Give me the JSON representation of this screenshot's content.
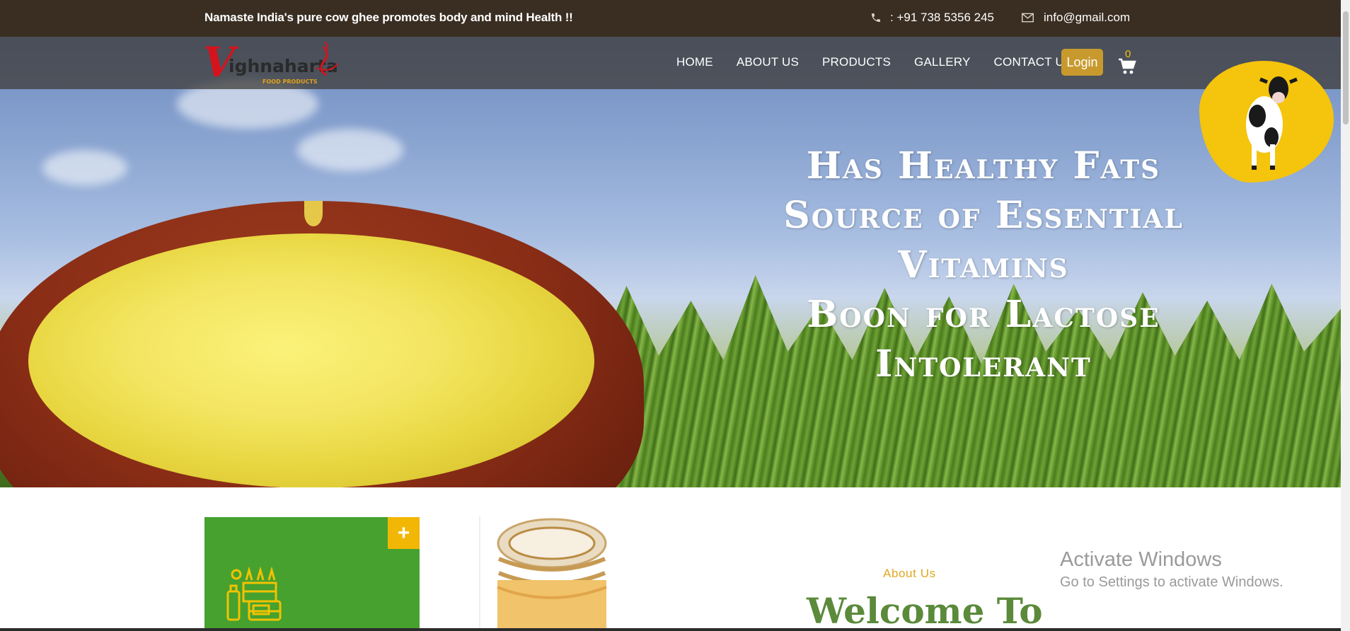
{
  "topbar": {
    "tagline": "Namaste India's pure cow ghee promotes body and mind Health !!",
    "phone": ": +91 738 5356 245",
    "email": "info@gmail.com",
    "phone_icon": "phone-icon",
    "email_icon": "envelope-icon"
  },
  "brand": {
    "logo_text": "ighnaharta",
    "logo_initial": "V",
    "logo_sub": "FOOD PRODUCTS"
  },
  "nav": {
    "items": [
      {
        "label": "HOME"
      },
      {
        "label": "ABOUT US"
      },
      {
        "label": "PRODUCTS"
      },
      {
        "label": "GALLERY"
      },
      {
        "label": "CONTACT US"
      }
    ],
    "login_label": "Login",
    "cart_count": "0",
    "cart_icon": "shopping-cart-icon"
  },
  "hero": {
    "lines": [
      "Has Healthy Fats",
      "Source of Essential Vitamins",
      "Boon for Lactose Intolerant"
    ]
  },
  "feature": {
    "plus_label": "+",
    "icon": "farm-products-icon"
  },
  "about": {
    "label": "About Us",
    "heading": "Welcome To"
  },
  "watermark": {
    "title": "Activate Windows",
    "subtitle": "Go to Settings to activate Windows."
  },
  "colors": {
    "topbar_bg": "#3a2e22",
    "login_bg": "#c89a2e",
    "feature_green": "#46a12f",
    "plus_yellow": "#f2b705",
    "heading_green": "#5a8a3a",
    "about_label": "#e0a820"
  }
}
